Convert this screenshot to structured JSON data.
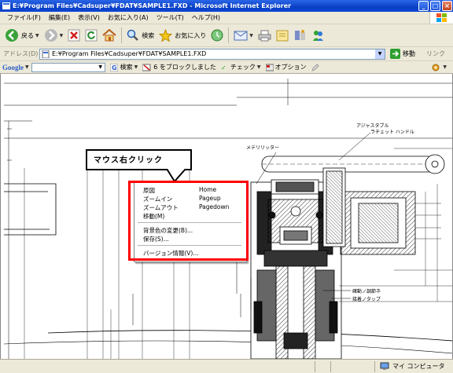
{
  "window": {
    "title": "E:¥Program Files¥Cadsuper¥FDAT¥SAMPLE1.FXD - Microsoft Internet Explorer",
    "minimize": "_",
    "maximize": "□",
    "close": "×"
  },
  "menubar": {
    "items": [
      "ファイル(F)",
      "編集(E)",
      "表示(V)",
      "お気に入り(A)",
      "ツール(T)",
      "ヘルプ(H)"
    ]
  },
  "toolbar": {
    "back_label": "戻る",
    "search_label": "検索",
    "favorites_label": "お気に入り"
  },
  "address": {
    "label": "アドレス(D)",
    "value": "E:¥Program Files¥Cadsuper¥FDAT¥SAMPLE1.FXD",
    "go_label": "移動",
    "links_label": "リンク"
  },
  "googlebar": {
    "logo": "Google",
    "search_label": "検索",
    "blocked_label": "6 をブロックしました",
    "check_label": "チェック",
    "options_label": "オプション"
  },
  "callout": {
    "text": "マウス右クリック"
  },
  "context_menu": {
    "items": [
      {
        "label": "原図",
        "shortcut": "Home"
      },
      {
        "label": "ズームイン",
        "shortcut": "Pageup"
      },
      {
        "label": "ズームアウト",
        "shortcut": "Pagedown"
      },
      {
        "label": "移動(M)",
        "shortcut": ""
      },
      {
        "label": "背景色の変更(B)...",
        "shortcut": ""
      },
      {
        "label": "保存(S)...",
        "shortcut": ""
      },
      {
        "label": "バージョン情報(V)...",
        "shortcut": ""
      }
    ]
  },
  "drawing_labels": {
    "label_1": "アジャスタブル",
    "label_2": "ラチェット ハンドル",
    "label_3": "メテリリッター",
    "label_4": "確動ノ調節ネ",
    "label_5": "接着ノタップ"
  },
  "statusbar": {
    "zone": "マイ コンピュータ"
  },
  "colors": {
    "titlebar": "#0a3fc4",
    "chrome": "#ece9d8",
    "highlight": "#ff0000"
  }
}
